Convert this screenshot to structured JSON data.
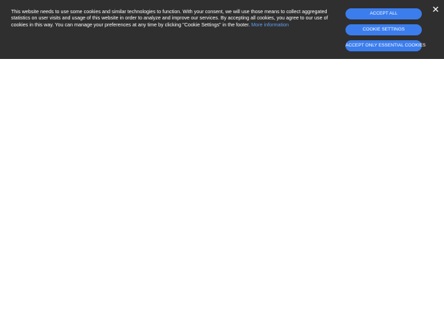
{
  "cookie_banner": {
    "message": "This website needs to use some cookies and similar technologies to function. With your consent, we will use those means to collect aggregated statistics on user visits and usage of this website in order to analyze and improve our services. By accepting all cookies, you agree to our use of cookies in this way. You can manage your preferences at any time by clicking \"Cookie Settings\" in the footer.",
    "more_info_label": "More information",
    "accept_all_label": "ACCEPT ALL",
    "cookie_settings_label": "COOKIE SETTINGS",
    "accept_essential_label": "ACCEPT ONLY ESSENTIAL COOKIES",
    "close_glyph": "✕"
  },
  "colors": {
    "banner_background": "#2f2f2f",
    "button_blue": "#3b7ded",
    "link_blue": "#5fa0f0",
    "page_background": "#ffffff"
  },
  "icons": {
    "close": "close-icon"
  }
}
